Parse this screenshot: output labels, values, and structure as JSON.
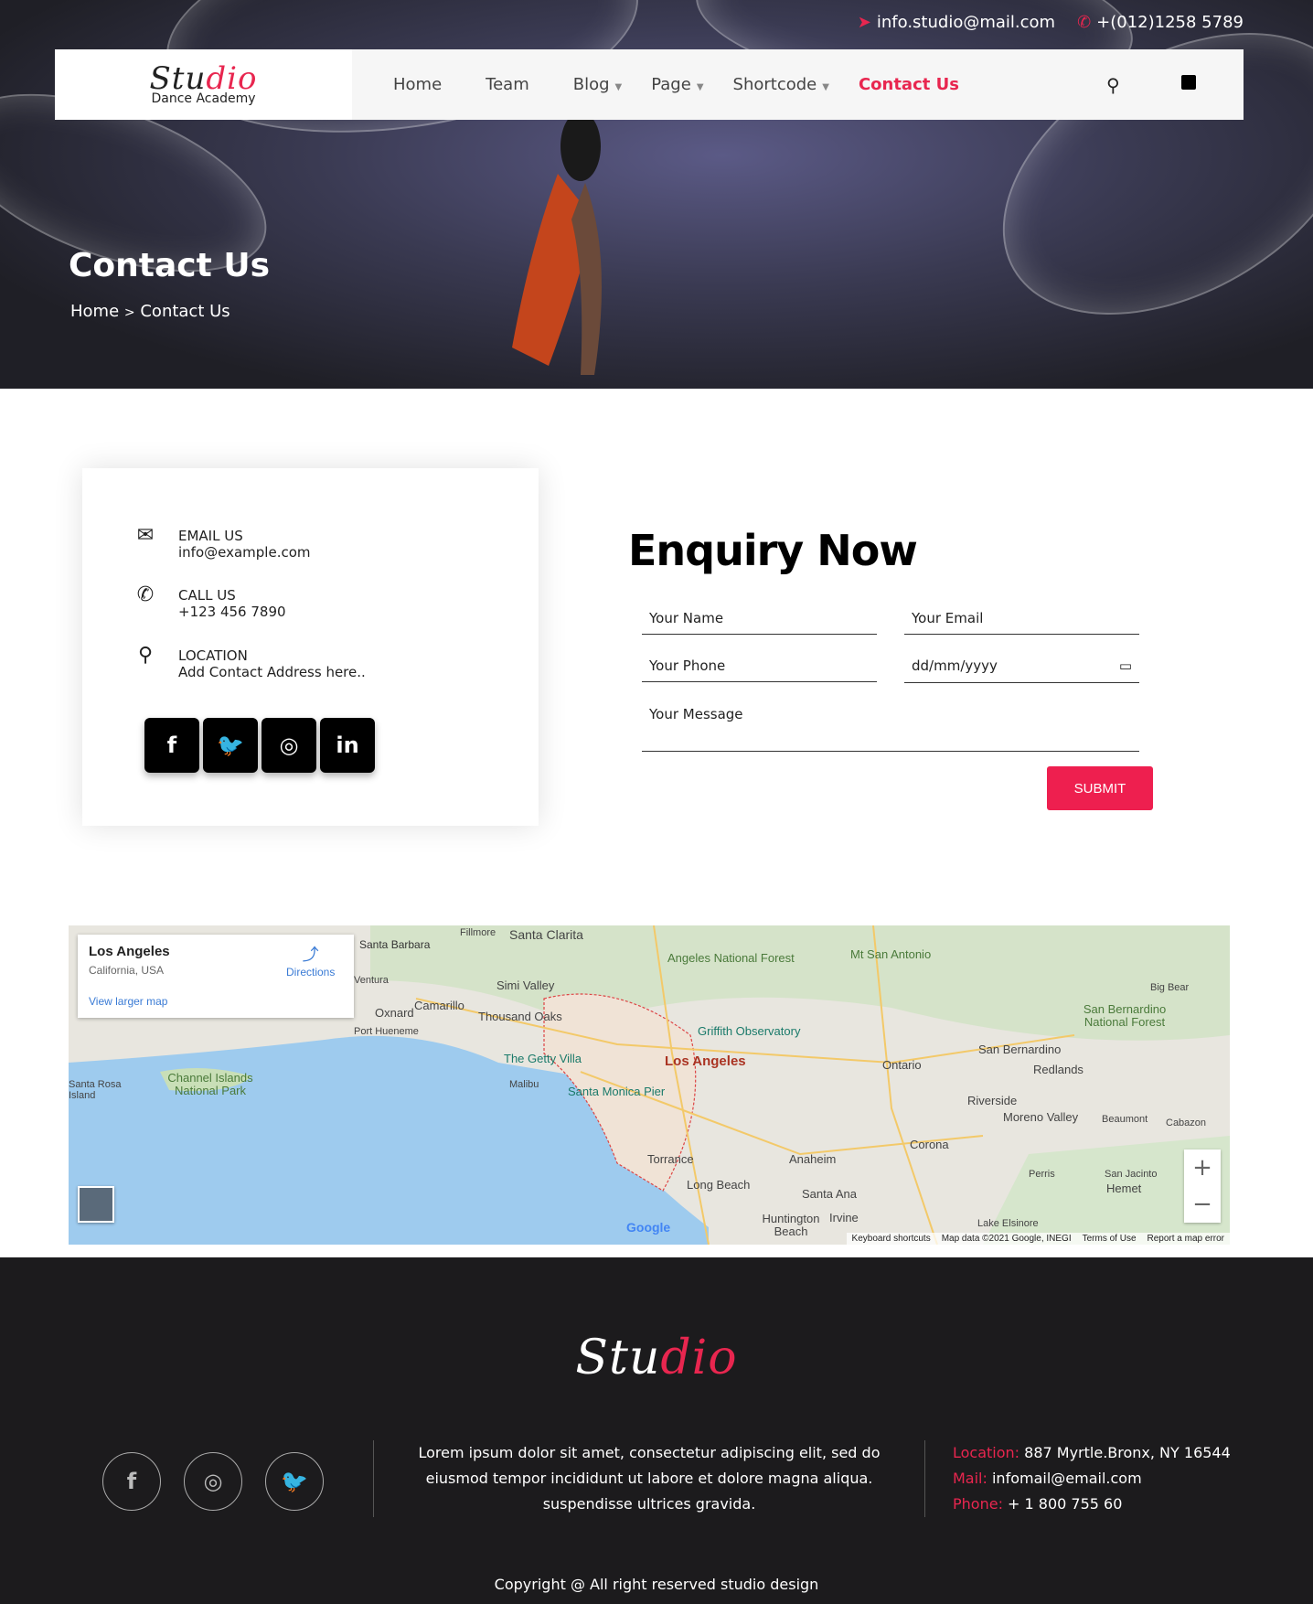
{
  "topbar": {
    "email": "info.studio@mail.com",
    "phone": "+(012)1258 5789",
    "email_icon": "paper-plane-icon",
    "phone_icon": "phone-icon"
  },
  "logo": {
    "text_dark": "Stu",
    "text_pink": "dio",
    "sub": "Dance Academy"
  },
  "nav": {
    "items": [
      {
        "label": "Home"
      },
      {
        "label": "Team"
      },
      {
        "label": "Blog",
        "dropdown": true
      },
      {
        "label": "Page",
        "dropdown": true
      },
      {
        "label": "Shortcode",
        "dropdown": true
      },
      {
        "label": "Contact Us",
        "active": true
      }
    ],
    "search_icon": "search-icon",
    "cart_icon": "shopping-bag-icon"
  },
  "hero": {
    "title": "Contact Us",
    "breadcrumb": {
      "home": "Home",
      "sep": ">",
      "current": "Contact Us"
    }
  },
  "contact_card": {
    "items": [
      {
        "icon": "envelope-icon",
        "label": "EMAIL US",
        "value": "info@example.com"
      },
      {
        "icon": "phone-icon",
        "label": "CALL US",
        "value": "+123 456 7890"
      },
      {
        "icon": "map-marker-icon",
        "label": "LOCATION",
        "value": "Add Contact Address here.."
      }
    ],
    "social": [
      {
        "icon": "facebook-icon",
        "glyph": "f"
      },
      {
        "icon": "twitter-icon",
        "glyph": "🐦"
      },
      {
        "icon": "instagram-icon",
        "glyph": "◎"
      },
      {
        "icon": "linkedin-icon",
        "glyph": "in"
      }
    ]
  },
  "form": {
    "title": "Enquiry Now",
    "name_placeholder": "Your Name",
    "email_placeholder": "Your Email",
    "phone_placeholder": "Your Phone",
    "date_placeholder": "dd/mm/yyyy",
    "message_placeholder": "Your Message",
    "submit": "SUBMIT"
  },
  "map": {
    "place": "Los Angeles",
    "region": "California, USA",
    "directions": "Directions",
    "larger": "View larger map",
    "footer_links": [
      "Keyboard shortcuts",
      "Map data ©2021 Google, INEGI",
      "Terms of Use",
      "Report a map error"
    ],
    "google": "Google",
    "labels": [
      "Santa Clarita",
      "Angeles National Forest",
      "Mt San Antonio",
      "Simi Valley",
      "Thousand Oaks",
      "Camarillo",
      "Oxnard",
      "Port Hueneme",
      "Fillmore",
      "Griffith Observatory",
      "Los Angeles",
      "The Getty Villa",
      "Santa Monica Pier",
      "Malibu",
      "Channel Islands National Park",
      "Santa Rosa Island",
      "San Bernardino",
      "San Bernardino National Forest",
      "Redlands",
      "Ontario",
      "Riverside",
      "Moreno Valley",
      "Beaumont",
      "Cabazon",
      "Big Bear",
      "Corona",
      "Anaheim",
      "Torrance",
      "Long Beach",
      "Santa Ana",
      "Irvine",
      "Huntington Beach",
      "Perris",
      "San Jacinto",
      "Hemet",
      "Lake Elsinore",
      "Santa Barbara",
      "Ventura"
    ]
  },
  "footer": {
    "logo_dark": "Stu",
    "logo_pink": "dio",
    "social": [
      {
        "icon": "facebook-icon",
        "glyph": "f"
      },
      {
        "icon": "instagram-icon",
        "glyph": "◎"
      },
      {
        "icon": "twitter-icon",
        "glyph": "🐦"
      }
    ],
    "text": "Lorem ipsum dolor sit amet, consectetur adipiscing elit, sed do eiusmod tempor incididunt ut labore et dolore magna aliqua. suspendisse ultrices gravida.",
    "location_label": "Location:",
    "location": "887 Myrtle.Bronx, NY 16544",
    "mail_label": "Mail:",
    "mail": "infomail@email.com",
    "phone_label": "Phone:",
    "phone": "+ 1 800 755 60",
    "copyright": "Copyright @ All right reserved studio design"
  },
  "colors": {
    "accent": "#e8264f",
    "footer_bg": "#1c1b1d",
    "submit": "#ee1f4f"
  }
}
